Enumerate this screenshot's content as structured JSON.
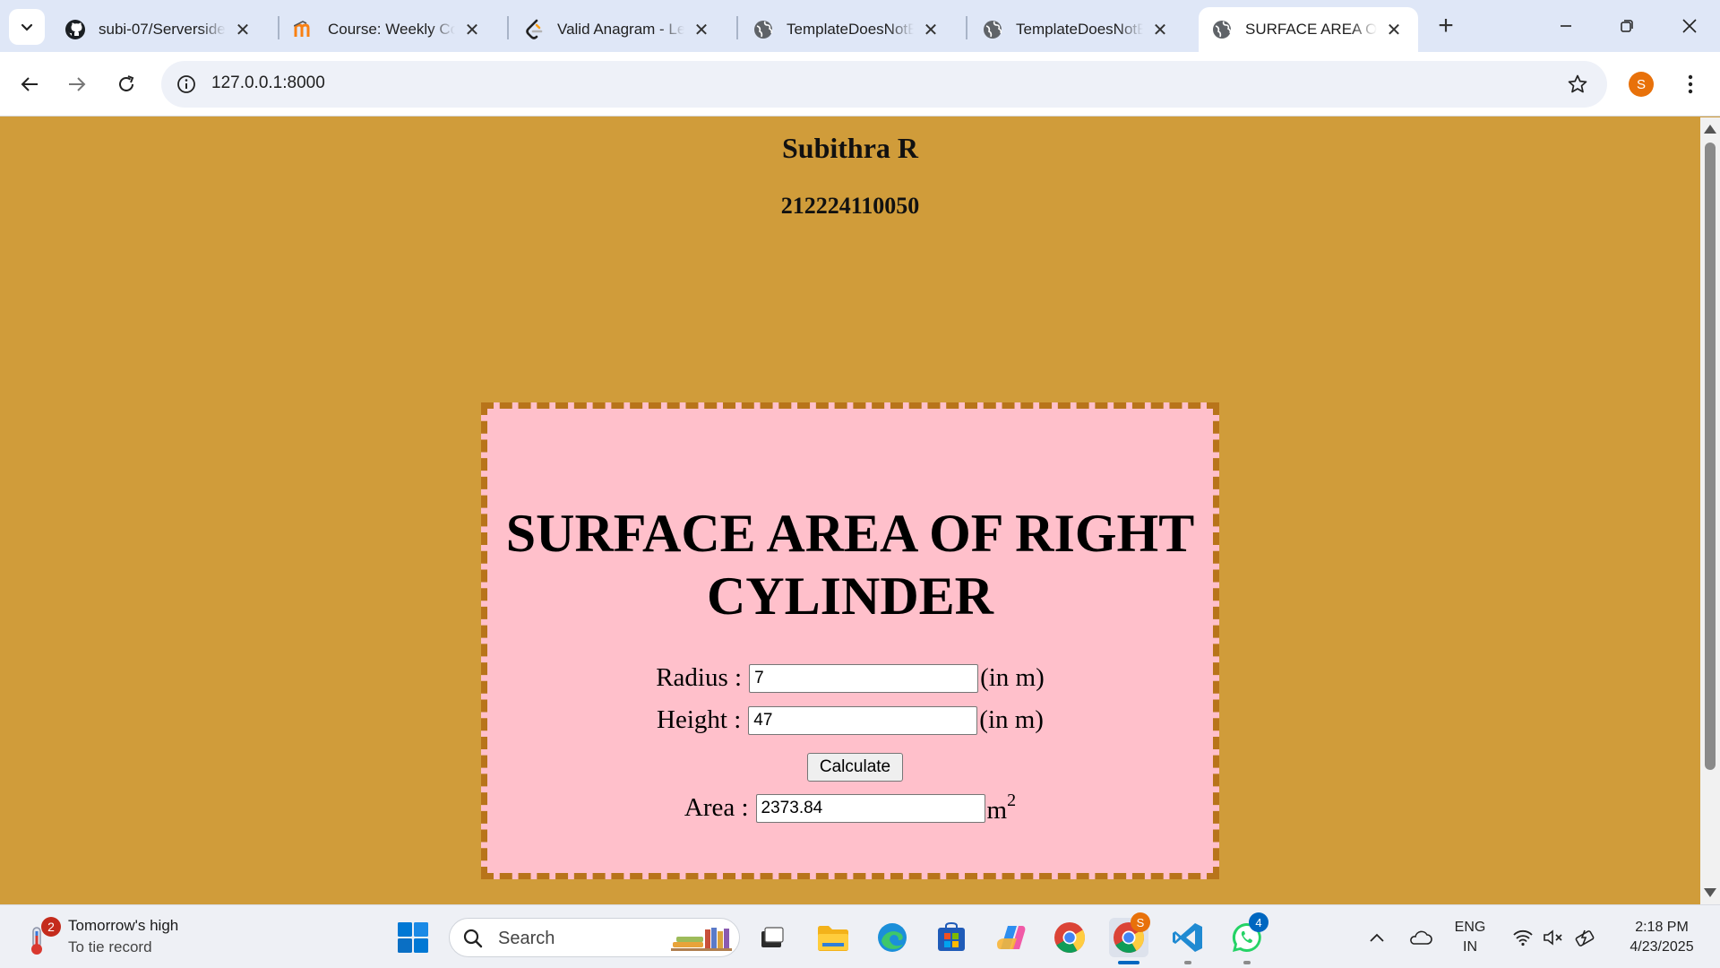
{
  "browser": {
    "tabs": [
      {
        "title": "subi-07/Serverside",
        "icon": "github-icon"
      },
      {
        "title": "Course: Weekly Co",
        "icon": "moodle-icon"
      },
      {
        "title": "Valid Anagram - Le",
        "icon": "leetcode-icon"
      },
      {
        "title": "TemplateDoesNotE",
        "icon": "globe-icon"
      },
      {
        "title": "TemplateDoesNotE",
        "icon": "globe-icon"
      },
      {
        "title": "SURFACE AREA OF",
        "icon": "globe-icon",
        "active": true
      }
    ],
    "url": "127.0.0.1:8000",
    "profile_initial": "S"
  },
  "page": {
    "student_name": "Subithra R",
    "student_id": "212224110050",
    "heading": "SURFACE AREA OF RIGHT CYLINDER",
    "radius_label": "Radius :",
    "radius_value": "7",
    "radius_unit": "(in m)",
    "height_label": "Height :",
    "height_value": "47",
    "height_unit": "(in m)",
    "calculate_label": "Calculate",
    "area_label": "Area :",
    "area_value": "2373.84",
    "area_unit": "m",
    "area_unit_power": "2",
    "colors": {
      "background": "#d09c3a",
      "card": "#ffc0cb",
      "card_border": "#b8741a"
    }
  },
  "taskbar": {
    "weather_badge": "2",
    "weather_title": "Tomorrow's high",
    "weather_sub": "To tie record",
    "search_placeholder": "Search",
    "chrome_badge": "S",
    "whatsapp_badge": "4",
    "lang_line1": "ENG",
    "lang_line2": "IN",
    "time": "2:18 PM",
    "date": "4/23/2025"
  }
}
